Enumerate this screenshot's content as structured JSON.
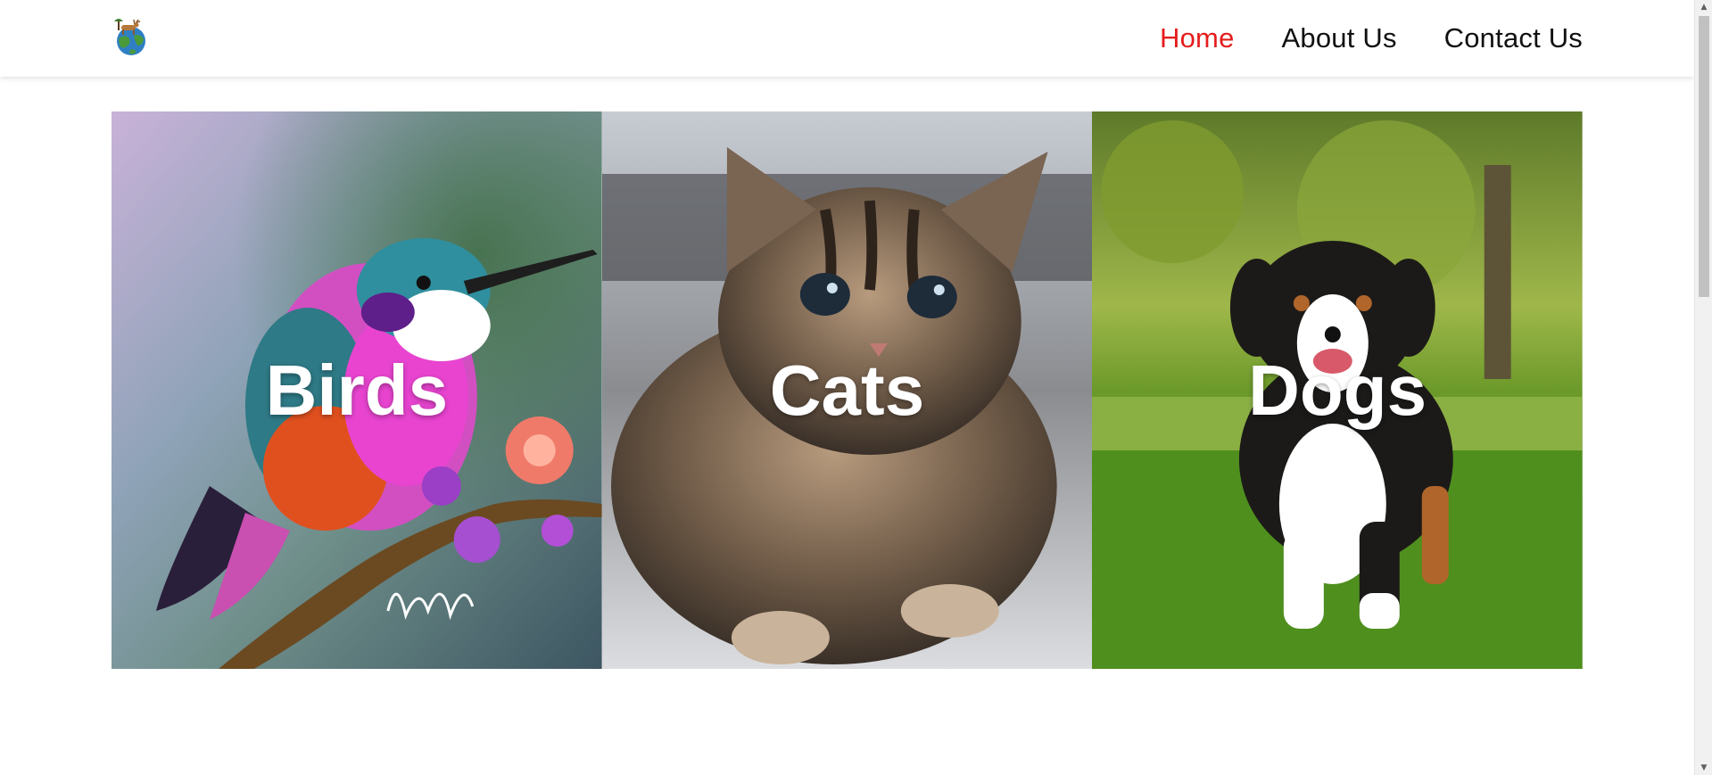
{
  "header": {
    "logo_icon": "earth-deer-logo-icon",
    "nav": [
      {
        "label": "Home",
        "active": true
      },
      {
        "label": "About Us",
        "active": false
      },
      {
        "label": "Contact Us",
        "active": false
      }
    ]
  },
  "gallery": {
    "cards": [
      {
        "label": "Birds",
        "image": "hummingbird-photo"
      },
      {
        "label": "Cats",
        "image": "tabby-kitten-photo"
      },
      {
        "label": "Dogs",
        "image": "tricolor-puppy-photo"
      }
    ]
  },
  "colors": {
    "nav_active": "#e51d1d",
    "nav_default": "#111111",
    "card_label": "#ffffff"
  }
}
